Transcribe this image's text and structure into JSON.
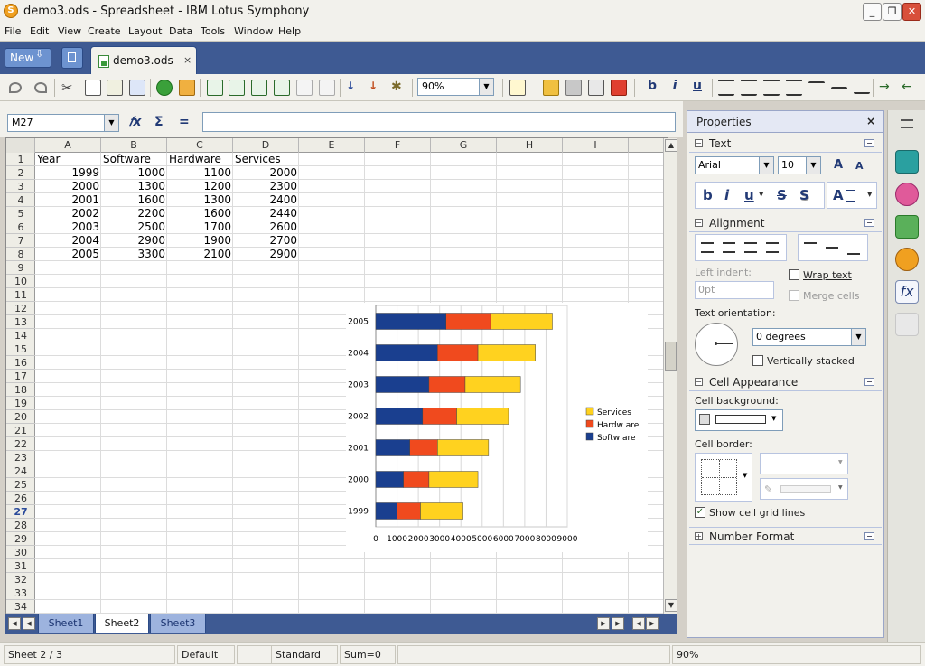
{
  "window": {
    "title": "demo3.ods - Spreadsheet - IBM Lotus Symphony",
    "min": "_",
    "max": "❐",
    "close": "✕"
  },
  "menu": [
    "File",
    "Edit",
    "View",
    "Create",
    "Layout",
    "Data",
    "Tools",
    "Window",
    "Help"
  ],
  "tabbar": {
    "new_label": "New",
    "new_arrow": "⇩",
    "doc_tab_label": "demo3.ods",
    "doc_tab_close": "×"
  },
  "toolbar": {
    "zoom": "90%",
    "bold": "b",
    "italic": "i",
    "underline": "u"
  },
  "formula": {
    "namebox": "M27",
    "fx": "𝑓x",
    "sum": "Σ",
    "equals": "="
  },
  "sheet": {
    "columns": [
      "A",
      "B",
      "C",
      "D",
      "E",
      "F",
      "G",
      "H",
      "I"
    ],
    "rows": [
      "1",
      "2",
      "3",
      "4",
      "5",
      "6",
      "7",
      "8",
      "9",
      "10",
      "11",
      "12",
      "13",
      "14",
      "15",
      "16",
      "17",
      "18",
      "19",
      "20",
      "21",
      "22",
      "23",
      "24",
      "25",
      "26",
      "27",
      "28",
      "29",
      "30",
      "31",
      "32",
      "33",
      "34"
    ],
    "active_row": "27",
    "headers": [
      "Year",
      "Software",
      "Hardware",
      "Services"
    ],
    "data": [
      [
        "1999",
        "1000",
        "1100",
        "2000"
      ],
      [
        "2000",
        "1300",
        "1200",
        "2300"
      ],
      [
        "2001",
        "1600",
        "1300",
        "2400"
      ],
      [
        "2002",
        "2200",
        "1600",
        "2440"
      ],
      [
        "2003",
        "2500",
        "1700",
        "2600"
      ],
      [
        "2004",
        "2900",
        "1900",
        "2700"
      ],
      [
        "2005",
        "3300",
        "2100",
        "2900"
      ]
    ]
  },
  "chart_data": {
    "type": "bar",
    "orientation": "horizontal",
    "stacked": true,
    "categories": [
      "1999",
      "2000",
      "2001",
      "2002",
      "2003",
      "2004",
      "2005"
    ],
    "series": [
      {
        "name": "Softw are",
        "values": [
          1000,
          1300,
          1600,
          2200,
          2500,
          2900,
          3300
        ],
        "color": "#1a3f8f"
      },
      {
        "name": "Hardw are",
        "values": [
          1100,
          1200,
          1300,
          1600,
          1700,
          1900,
          2100
        ],
        "color": "#f04a1e"
      },
      {
        "name": "Services",
        "values": [
          2000,
          2300,
          2400,
          2440,
          2600,
          2700,
          2900
        ],
        "color": "#ffd21f"
      }
    ],
    "x_ticks": [
      "0",
      "1000",
      "2000",
      "3000",
      "4000",
      "5000",
      "6000",
      "7000",
      "8000",
      "9000"
    ],
    "xlim": [
      0,
      9000
    ],
    "grid": true,
    "legend_position": "right"
  },
  "sheet_tabs": {
    "tabs": [
      "Sheet1",
      "Sheet2",
      "Sheet3"
    ],
    "active": "Sheet2"
  },
  "status": {
    "sheet": "Sheet 2 / 3",
    "style": "Default",
    "mode": "Standard",
    "sum": "Sum=0",
    "zoom": "90%"
  },
  "properties": {
    "title": "Properties",
    "close": "×",
    "text_section": "Text",
    "font": "Arial",
    "size": "10",
    "grow": "A",
    "shrink": "A",
    "bold": "b",
    "italic": "i",
    "underline": "u",
    "strike": "S",
    "shadow": "S",
    "fontcolor": "A",
    "alignment_section": "Alignment",
    "left_indent_label": "Left indent:",
    "left_indent_value": "0pt",
    "wrap_text": "Wrap text",
    "merge_cells": "Merge cells",
    "orientation_label": "Text orientation:",
    "orientation_value": "0 degrees",
    "vertically_stacked": "Vertically stacked",
    "cell_appearance_section": "Cell Appearance",
    "cell_background_label": "Cell background:",
    "cell_border_label": "Cell border:",
    "show_grid_lines": "Show cell grid lines",
    "number_format_section": "Number Format"
  }
}
